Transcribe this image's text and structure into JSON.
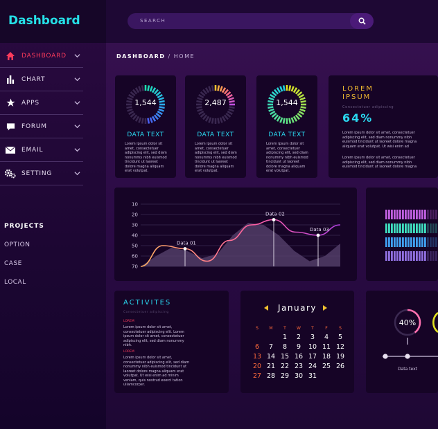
{
  "app": {
    "title": "Dashboard"
  },
  "search": {
    "placeholder": "SEARCH"
  },
  "sidebar": {
    "items": [
      {
        "label": "DASHBOARD",
        "icon": "home-icon",
        "active": true
      },
      {
        "label": "CHART",
        "icon": "bar-chart-icon"
      },
      {
        "label": "APPS",
        "icon": "star-icon"
      },
      {
        "label": "FORUM",
        "icon": "chat-icon"
      },
      {
        "label": "EMAIL",
        "icon": "mail-icon"
      },
      {
        "label": "SETTING",
        "icon": "gear-icon"
      }
    ],
    "projects_title": "PROJECTS",
    "projects": [
      "OPTION",
      "CASE",
      "LOCAL"
    ]
  },
  "breadcrumb": {
    "section": "DASHBOARD",
    "sep": "/",
    "page": "HOME"
  },
  "stats": [
    {
      "value": "1,544",
      "title": "DATA TEXT",
      "body": "Lorem ipsum dolor sit amet, consectetuer adipiscing elit, sed diam nonummy nibh euismod tincidunt ut laoreet dolore magna aliquam erat volutpat.",
      "fill": 0.5,
      "colors": [
        "#1ee0b0",
        "#2ab0f0",
        "#4a60f0"
      ]
    },
    {
      "value": "2,487",
      "title": "DATA TEXT",
      "body": "Lorem ipsum dolor sit amet, consectetuer adipiscing elit, sed diam nonummy nibh euismod tincidunt ut laoreet dolore magna aliquam erat volutpat.",
      "fill": 0.28,
      "colors": [
        "#f0c030",
        "#ff6a7c",
        "#c050e0"
      ]
    },
    {
      "value": "1,544",
      "title": "DATA TEXT",
      "body": "Lorem ipsum dolor sit amet, consectetuer adipiscing elit, sed diam nonummy nibh euismod tincidunt ut laoreet dolore magna aliquam erat volutpat.",
      "fill": 1.0,
      "colors": [
        "#e0e020",
        "#60e080",
        "#1ed0e0"
      ]
    }
  ],
  "lorem": {
    "title": "LOREM IPSUM",
    "subtitle": "Consectetuer adipiscing",
    "percent": "64%",
    "body1": "Lorem ipsum dolor sit amet, consectetuer adipiscing elit, sed diam nonummy nibh euismod tincidunt ut laoreet dolore magna aliquam erat volutpat. Ut wisi enim ad",
    "body2": "Lorem ipsum dolor sit amet, consectetuer adipiscing elit, sed diam nonummy nibh euismod tincidunt ut laoreet dolore magna"
  },
  "chart_data": {
    "type": "line",
    "yticks": [
      10,
      20,
      30,
      40,
      50,
      60,
      70
    ],
    "ylim": [
      10,
      70
    ],
    "series": [
      {
        "values": [
          70,
          50,
          53,
          65,
          45,
          30,
          25,
          37,
          40,
          30
        ]
      }
    ],
    "area": [
      70,
      60,
      52,
      55,
      62,
      58,
      40,
      28,
      30,
      40,
      55,
      65,
      60,
      48
    ],
    "annotations": [
      {
        "label": "Data 01",
        "index": 2
      },
      {
        "label": "Data 02",
        "index": 6
      },
      {
        "label": "Data 03",
        "index": 8
      }
    ]
  },
  "colorbars": {
    "colors": [
      "#c060e0",
      "#40e0c0",
      "#40a0f0",
      "#9070e0"
    ]
  },
  "activities": {
    "title": "ACTIVITES",
    "subtitle": "Consectetuer adipiscing",
    "entries": [
      {
        "head": "LOREM",
        "body": "Lorem ipsum dolor sit amet, consectetuer adipiscing elit. Lorem ipsum dolor sit amet, consectetuer adipiscing elit, sed diam nonummy nibh."
      },
      {
        "head": "LOREM",
        "body": "Lorem ipsum dolor sit amet, consectetuer adipiscing elit, sed diam nonummy nibh euismod tincidunt ut laoreet dolore magna aliquam erat volutpat. Ut wisi enim ad minim veniam, quis nostrud exerci tation ullamcorper."
      }
    ]
  },
  "calendar": {
    "month": "January",
    "weekdays": [
      "S",
      "M",
      "T",
      "W",
      "T",
      "F",
      "S"
    ],
    "rows": [
      [
        "",
        "",
        "",
        "1",
        "2",
        "3",
        "4",
        "5"
      ],
      [
        "6",
        "7",
        "8",
        "9",
        "10",
        "11",
        "12"
      ],
      [
        "13",
        "14",
        "15",
        "16",
        "17",
        "18",
        "19"
      ],
      [
        "20",
        "21",
        "22",
        "23",
        "24",
        "25",
        "26"
      ],
      [
        "27",
        "28",
        "29",
        "30",
        "31",
        "",
        ""
      ]
    ]
  },
  "gauge": {
    "value": "40%",
    "fill": 0.4,
    "label": "Data text"
  }
}
